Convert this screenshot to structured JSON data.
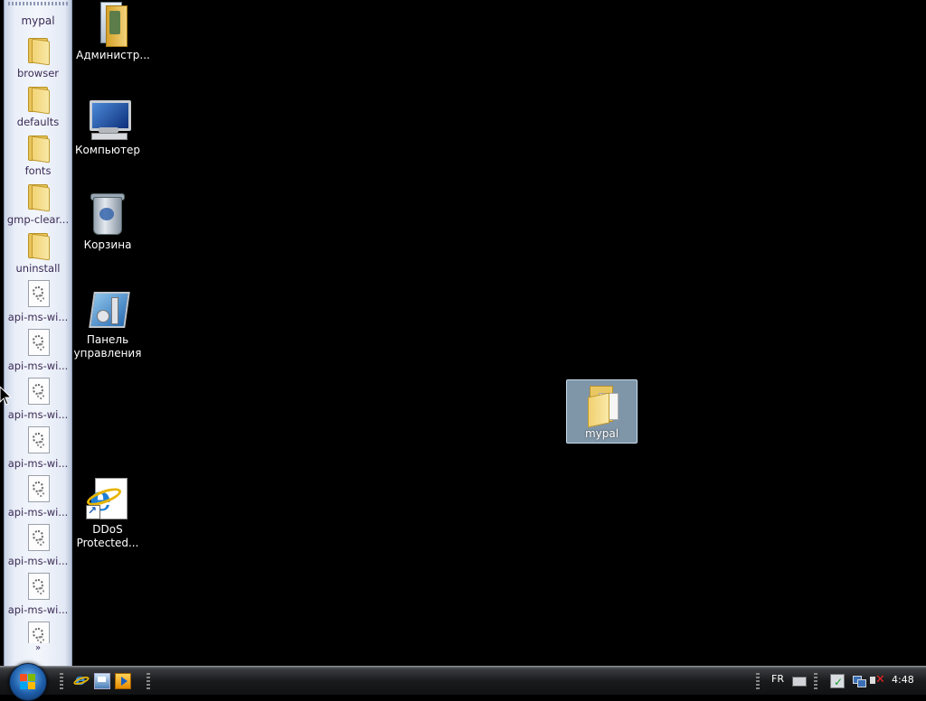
{
  "sidebar": {
    "title": "mypal",
    "items": [
      {
        "label": "browser",
        "icon": "folder-icon"
      },
      {
        "label": "defaults",
        "icon": "folder-icon"
      },
      {
        "label": "fonts",
        "icon": "folder-icon"
      },
      {
        "label": "gmp-clear...",
        "icon": "folder-icon"
      },
      {
        "label": "uninstall",
        "icon": "folder-icon"
      },
      {
        "label": "api-ms-wi...",
        "icon": "dll-file-icon"
      },
      {
        "label": "api-ms-wi...",
        "icon": "dll-file-icon"
      },
      {
        "label": "api-ms-wi...",
        "icon": "dll-file-icon"
      },
      {
        "label": "api-ms-wi...",
        "icon": "dll-file-icon"
      },
      {
        "label": "api-ms-wi...",
        "icon": "dll-file-icon"
      },
      {
        "label": "api-ms-wi...",
        "icon": "dll-file-icon"
      },
      {
        "label": "api-ms-wi...",
        "icon": "dll-file-icon"
      }
    ],
    "more_label": "»"
  },
  "desktop": {
    "icons": [
      {
        "label": "Администр...",
        "icon": "admin-tools-folder-icon"
      },
      {
        "label": "Компьютер",
        "icon": "computer-icon"
      },
      {
        "label": "Корзина",
        "icon": "recycle-bin-icon"
      },
      {
        "label_line1": "Панель",
        "label_line2": "управления",
        "icon": "control-panel-icon"
      },
      {
        "label_line1": "DDoS",
        "label_line2": "Protected...",
        "icon": "internet-explorer-shortcut-icon"
      }
    ],
    "selected_folder": {
      "label": "mypal",
      "icon": "folder-icon"
    }
  },
  "taskbar": {
    "start_icon": "windows-start-orb-icon",
    "quick_launch": [
      "internet-explorer-icon",
      "show-desktop-icon",
      "media-player-icon"
    ],
    "language": "FR",
    "clock": "4:48"
  },
  "colors": {
    "desktop_background": "#000000",
    "selection": "#aac8e1",
    "sidebar_text": "#3a2a55"
  }
}
